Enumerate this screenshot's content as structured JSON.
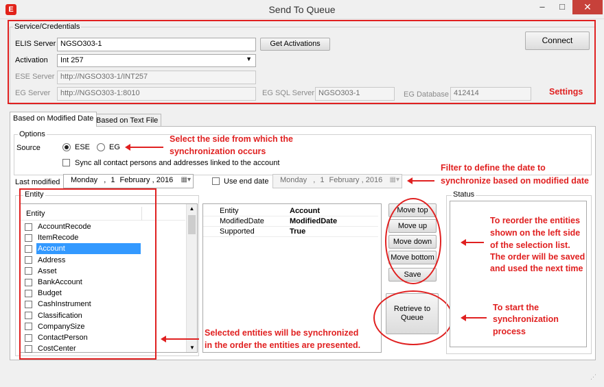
{
  "window": {
    "title": "Send To Queue",
    "app_icon_letter": "E",
    "minimize": "–",
    "maximize": "□",
    "close": "✕"
  },
  "service": {
    "group_label": "Service/Credentials",
    "elis_server_label": "ELIS Server",
    "elis_server_value": "NGSO303-1",
    "get_activations_button": "Get Activations",
    "activation_label": "Activation",
    "activation_value": "Int 257",
    "ese_server_label": "ESE Server",
    "ese_server_value": "http://NGSO303-1/INT257",
    "eg_server_label": "EG Server",
    "eg_server_value": "http://NGSO303-1:8010",
    "eg_sql_label": "EG SQL Server",
    "eg_sql_value": "NGSO303-1",
    "eg_db_label": "EG Database",
    "eg_db_value": "412414",
    "connect_button": "Connect"
  },
  "tabs": [
    {
      "label": "Based on Modified Date",
      "active": true
    },
    {
      "label": "Based on Text File",
      "active": false
    }
  ],
  "options": {
    "group_label": "Options",
    "source_label": "Source",
    "source_options": [
      {
        "label": "ESE",
        "selected": true
      },
      {
        "label": "EG",
        "selected": false
      }
    ],
    "sync_all_label": "Sync all contact persons and addresses linked to the account",
    "last_modified_label": "Last modified",
    "last_modified_date": {
      "weekday": "Monday",
      "day": "1",
      "month": "February",
      "year": "2016"
    },
    "use_end_date_label": "Use end date",
    "end_date": {
      "weekday": "Monday",
      "day": "1",
      "month": "February",
      "year": "2016"
    }
  },
  "entity": {
    "group_label": "Entity",
    "column_header": "Entity",
    "items": [
      "AccountRecode",
      "ItemRecode",
      "Account",
      "Address",
      "Asset",
      "BankAccount",
      "Budget",
      "CashInstrument",
      "Classification",
      "CompanySize",
      "ContactPerson",
      "CostCenter"
    ],
    "selected_index": 2
  },
  "details": [
    {
      "key": "Entity",
      "value": "Account"
    },
    {
      "key": "ModifiedDate",
      "value": "ModifiedDate"
    },
    {
      "key": "Supported",
      "value": "True"
    }
  ],
  "buttons": {
    "move_top": "Move top",
    "move_up": "Move up",
    "move_down": "Move down",
    "move_bottom": "Move bottom",
    "save": "Save",
    "retrieve_line1": "Retrieve to",
    "retrieve_line2": "Queue"
  },
  "status": {
    "group_label": "Status"
  },
  "annotations": {
    "settings": "Settings",
    "select_side_1": "Select the side from which the",
    "select_side_2": "synchronization occurs",
    "filter_1": "Filter to define the date to",
    "filter_2": "synchronize based on modified date",
    "reorder_1": "To reorder the entities",
    "reorder_2": "shown on the left side",
    "reorder_3": "of the selection list.",
    "reorder_4": "The order will be saved",
    "reorder_5": "and used the next time",
    "start_1": "To start the",
    "start_2": "synchronization",
    "start_3": "process",
    "selected_1": "Selected entities will be synchronized",
    "selected_2": "in the order the entities are presented."
  },
  "colors": {
    "annotation_red": "#e02020",
    "selection_blue": "#3399ff",
    "close_red": "#c7413a"
  }
}
